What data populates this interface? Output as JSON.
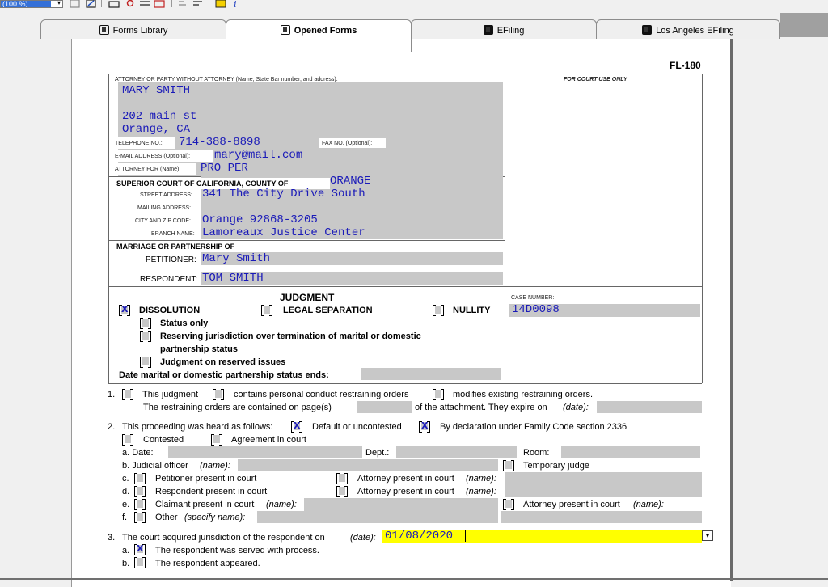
{
  "toolbar": {
    "zoom_value": "(100 %)",
    "zoom_arrow": "▾"
  },
  "tabs": [
    {
      "label": "Forms Library"
    },
    {
      "label": "Opened Forms"
    },
    {
      "label": "EFiling"
    },
    {
      "label": "Los Angeles EFiling"
    }
  ],
  "form": {
    "form_id": "FL-180",
    "header": {
      "attorney_label": "ATTORNEY OR PARTY WITHOUT ATTORNEY (Name, State Bar number, and address):",
      "court_use_label": "FOR COURT USE ONLY",
      "name": "MARY SMITH",
      "address1": "202 main st",
      "address2": "Orange, CA",
      "telephone_label": "TELEPHONE NO.:",
      "telephone": "714-388-8898",
      "fax_label": "FAX NO. (Optional):",
      "email_label": "E-MAIL ADDRESS (Optional):",
      "email": "mary@mail.com",
      "attorney_for_label": "ATTORNEY FOR (Name):",
      "attorney_for": "PRO PER",
      "court_label": "SUPERIOR COURT OF CALIFORNIA, COUNTY OF",
      "county": "ORANGE",
      "street_label": "STREET ADDRESS:",
      "street": "341 The City Drive South",
      "mailing_label": "MAILING ADDRESS:",
      "city_label": "CITY AND ZIP CODE:",
      "city": "Orange 92868-3205",
      "branch_label": "BRANCH NAME:",
      "branch": "Lamoreaux Justice Center",
      "marriage_label": "MARRIAGE OR PARTNERSHIP OF",
      "petitioner_label": "PETITIONER:",
      "petitioner": "Mary Smith",
      "respondent_label": "RESPONDENT:",
      "respondent": "TOM SMITH",
      "judgment_title": "JUDGMENT",
      "dissolution": "DISSOLUTION",
      "legal_separation": "LEGAL SEPARATION",
      "nullity": "NULLITY",
      "status_only": "Status only",
      "reserving1": "Reserving jurisdiction over termination of marital or domestic",
      "reserving2": "partnership status",
      "reserved_issues": "Judgment on reserved issues",
      "date_ends_label": "Date marital or domestic partnership status ends:",
      "case_number_label": "CASE NUMBER:",
      "case_number": "14D0098",
      "check_x": "X"
    },
    "item1": {
      "num": "1.",
      "a": "This judgment",
      "b": "contains personal conduct restraining orders",
      "c": "modifies existing restraining orders.",
      "d": "The restraining orders are contained on page(s)",
      "e": "of the attachment. They expire on",
      "e_date": "(date):"
    },
    "item2": {
      "num": "2.",
      "a": "This proceeding was heard as follows:",
      "b": "Default or uncontested",
      "c": "By declaration under Family Code section 2336",
      "contested": "Contested",
      "agreement": "Agreement in court",
      "date": "a.  Date:",
      "dept": "Dept.:",
      "room": "Room:",
      "judicial": "b.  Judicial officer",
      "judicial_name": "(name):",
      "temp_judge": "Temporary judge",
      "c_pet": "c.",
      "pet_present": "Petitioner present in court",
      "att_present1": "Attorney present in court",
      "att_name": "(name):",
      "d_resp": "d.",
      "resp_present": "Respondent present in court",
      "att_present2": "Attorney present in court",
      "e_cla": "e.",
      "claimant": "Claimant present in court",
      "att_present3": "Attorney present in court",
      "f_other": "f.",
      "other": "Other",
      "other_spec": "(specify name):"
    },
    "item3": {
      "num": "3.",
      "text": "The court acquired jurisdiction of the respondent on",
      "date_label": "(date):",
      "date_value": "01/08/2020",
      "a_text": "The respondent was served with process.",
      "b_text": "The respondent appeared.",
      "a": "a.",
      "b": "b."
    }
  }
}
